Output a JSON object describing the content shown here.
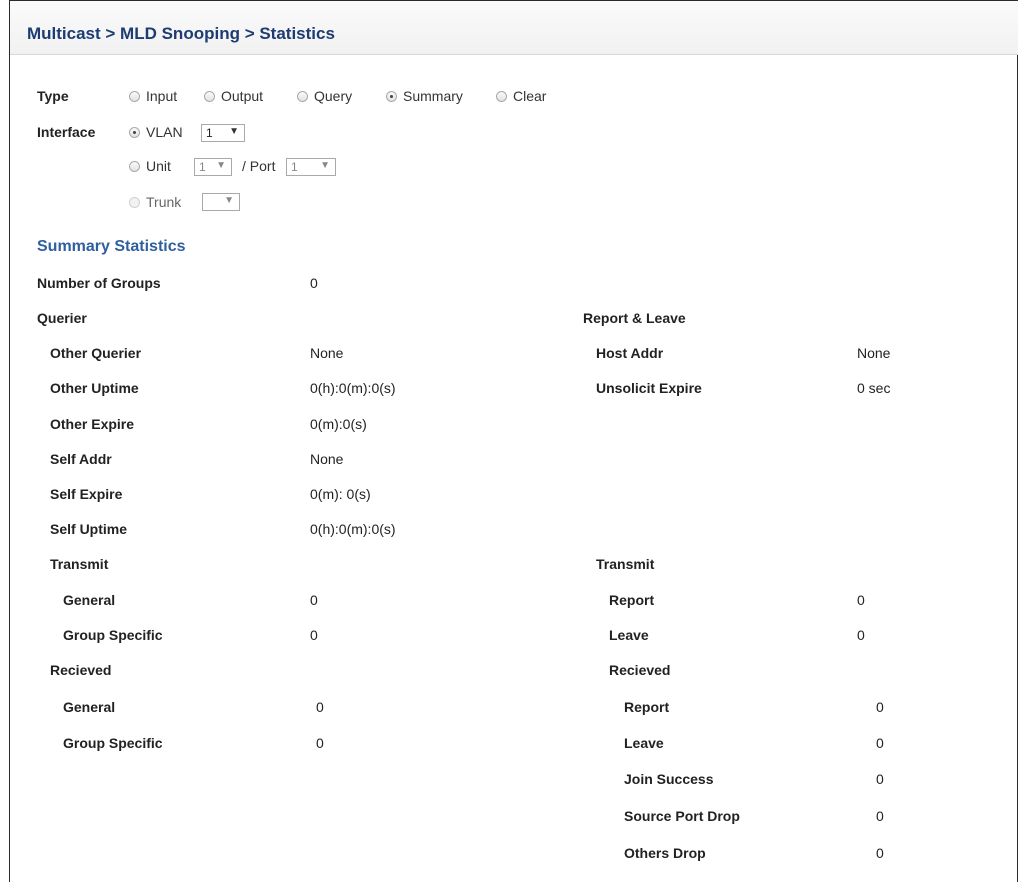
{
  "title": "Multicast > MLD Snooping > Statistics",
  "type": {
    "label": "Type",
    "options": [
      "Input",
      "Output",
      "Query",
      "Summary",
      "Clear"
    ],
    "selected": "Summary"
  },
  "interface": {
    "label": "Interface",
    "vlan_label": "VLAN",
    "vlan_value": "1",
    "unit_label": "Unit",
    "unit_value": "1",
    "port_label": "/ Port",
    "port_value": "1",
    "trunk_label": "Trunk",
    "trunk_value": "",
    "selected": "VLAN"
  },
  "summary": {
    "heading": "Summary Statistics",
    "number_of_groups": {
      "label": "Number of Groups",
      "value": "0"
    },
    "querier": {
      "heading": "Querier",
      "other_querier": {
        "label": "Other Querier",
        "value": "None"
      },
      "other_uptime": {
        "label": "Other Uptime",
        "value": "0(h):0(m):0(s)"
      },
      "other_expire": {
        "label": "Other Expire",
        "value": "0(m):0(s)"
      },
      "self_addr": {
        "label": "Self Addr",
        "value": "None"
      },
      "self_expire": {
        "label": "Self Expire",
        "value": "0(m): 0(s)"
      },
      "self_uptime": {
        "label": "Self Uptime",
        "value": "0(h):0(m):0(s)"
      },
      "transmit": {
        "heading": "Transmit",
        "general": {
          "label": "General",
          "value": "0"
        },
        "group_specific": {
          "label": "Group Specific",
          "value": "0"
        }
      },
      "received": {
        "heading": "Recieved",
        "general": {
          "label": "General",
          "value": "0"
        },
        "group_specific": {
          "label": "Group Specific",
          "value": "0"
        }
      }
    },
    "report_leave": {
      "heading": "Report & Leave",
      "host_addr": {
        "label": "Host Addr",
        "value": "None"
      },
      "unsolicit_expire": {
        "label": "Unsolicit Expire",
        "value": "0 sec"
      },
      "transmit": {
        "heading": "Transmit",
        "report": {
          "label": "Report",
          "value": "0"
        },
        "leave": {
          "label": "Leave",
          "value": "0"
        }
      },
      "received": {
        "heading": "Recieved",
        "report": {
          "label": "Report",
          "value": "0"
        },
        "leave": {
          "label": "Leave",
          "value": "0"
        },
        "join_success": {
          "label": "Join Success",
          "value": "0"
        },
        "source_port_drop": {
          "label": "Source Port Drop",
          "value": "0"
        },
        "others_drop": {
          "label": "Others Drop",
          "value": "0"
        }
      }
    }
  }
}
